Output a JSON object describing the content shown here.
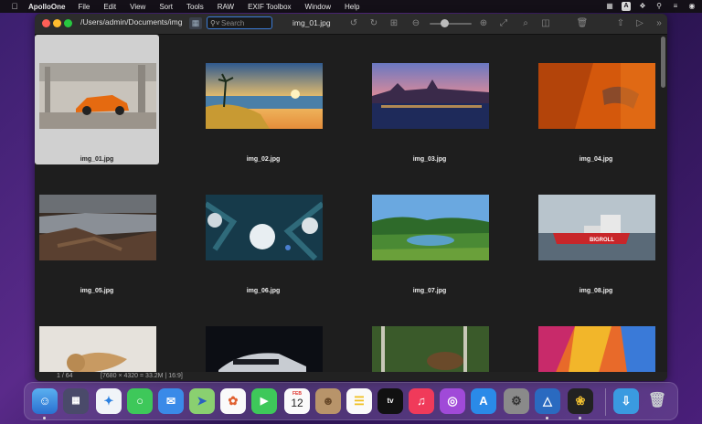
{
  "menubar": {
    "apple_icon": "apple-logo-icon",
    "items": [
      "ApolloOne",
      "File",
      "Edit",
      "View",
      "Sort",
      "Tools",
      "RAW",
      "EXIF Toolbox",
      "Window",
      "Help"
    ]
  },
  "window": {
    "path": "/Users/admin/Documents/img",
    "search_placeholder": "Search",
    "filename": "img_01.jpg"
  },
  "thumbnails": [
    {
      "name": "img_01.jpg",
      "selected": true
    },
    {
      "name": "img_02.jpg"
    },
    {
      "name": "img_03.jpg"
    },
    {
      "name": "img_04.jpg"
    },
    {
      "name": "img_05.jpg"
    },
    {
      "name": "img_06.jpg"
    },
    {
      "name": "img_07.jpg"
    },
    {
      "name": "img_08.jpg"
    },
    {
      "name": ""
    },
    {
      "name": ""
    },
    {
      "name": ""
    },
    {
      "name": ""
    }
  ],
  "status": {
    "count": "1 / 64",
    "info": "[7680 × 4320 = 33.2M | 16:9]"
  },
  "dock": {
    "calendar_month": "FEB",
    "calendar_day": "12",
    "tv_label": "tv"
  }
}
